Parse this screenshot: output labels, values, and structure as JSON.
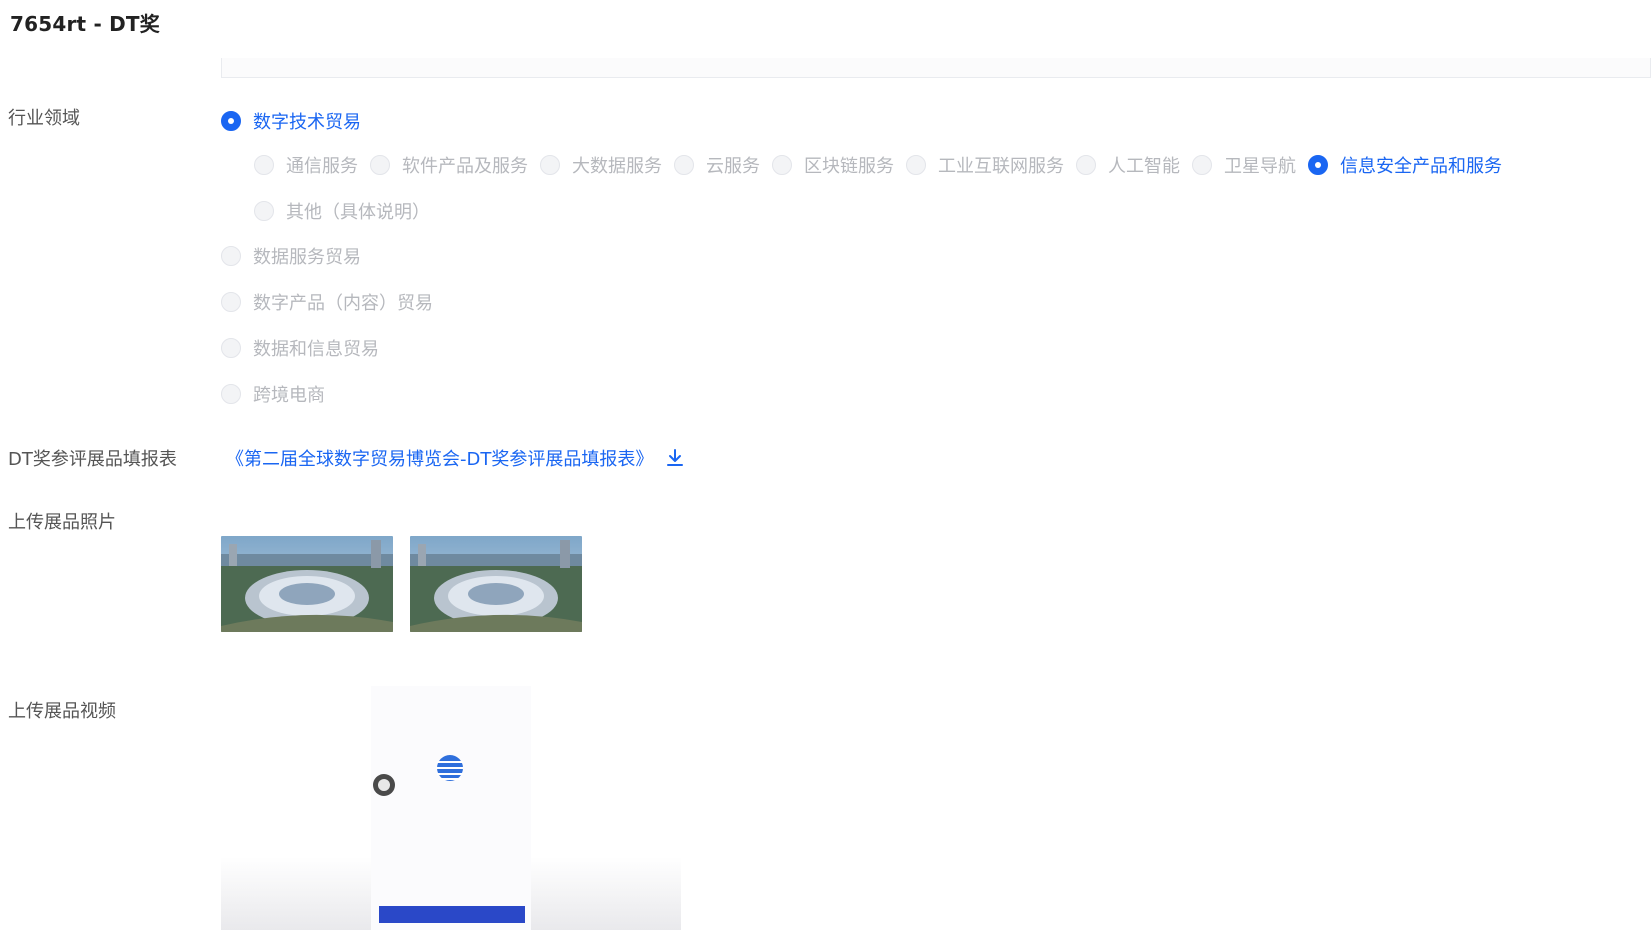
{
  "header": {
    "title": "7654rt - DT奖"
  },
  "industry": {
    "label": "行业领域",
    "top_option": "数字技术贸易",
    "sub_options": [
      "通信服务",
      "软件产品及服务",
      "大数据服务",
      "云服务",
      "区块链服务",
      "工业互联网服务",
      "人工智能",
      "卫星导航",
      "信息安全产品和服务"
    ],
    "sub_other": "其他（具体说明）",
    "other_options": [
      "数据服务贸易",
      "数字产品（内容）贸易",
      "数据和信息贸易",
      "跨境电商"
    ],
    "selected_top": "数字技术贸易",
    "selected_sub": "信息安全产品和服务"
  },
  "form_sheet": {
    "label": "DT奖参评展品填报表",
    "link_text": "《第二届全球数字贸易博览会-DT奖参评展品填报表》",
    "icon": "download-icon"
  },
  "photos": {
    "label": "上传展品照片",
    "count": 2
  },
  "video": {
    "label": "上传展品视频"
  },
  "colors": {
    "accent": "#1a66f2",
    "label_text": "#555555",
    "disabled_text": "#b6b8bd"
  }
}
